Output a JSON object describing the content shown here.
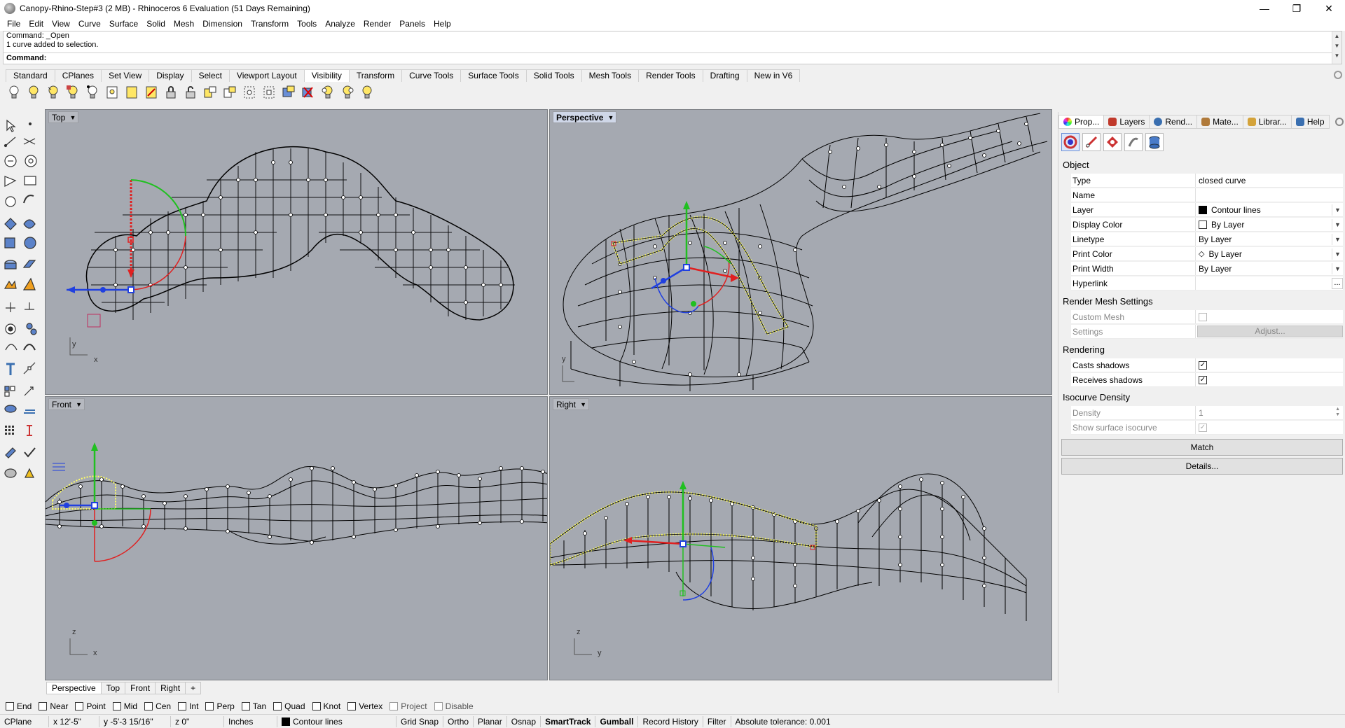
{
  "window": {
    "title": "Canopy-Rhino-Step#3 (2 MB) - Rhinoceros 6 Evaluation (51 Days Remaining)",
    "minimize": "—",
    "restore": "❐",
    "close": "✕"
  },
  "menu": [
    "File",
    "Edit",
    "View",
    "Curve",
    "Surface",
    "Solid",
    "Mesh",
    "Dimension",
    "Transform",
    "Tools",
    "Analyze",
    "Render",
    "Panels",
    "Help"
  ],
  "command": {
    "history": [
      "Command: _Open",
      "1 curve added to selection."
    ],
    "prompt": "Command:"
  },
  "toolbar_tabs": [
    "Standard",
    "CPlanes",
    "Set View",
    "Display",
    "Select",
    "Viewport Layout",
    "Visibility",
    "Transform",
    "Curve Tools",
    "Surface Tools",
    "Solid Tools",
    "Mesh Tools",
    "Render Tools",
    "Drafting",
    "New in V6"
  ],
  "toolbar_active": "Visibility",
  "viewports": {
    "top": "Top",
    "perspective": "Perspective",
    "front": "Front",
    "right": "Right",
    "axis_x": "x",
    "axis_y": "y",
    "axis_z": "z"
  },
  "viewport_tabs": [
    "Perspective",
    "Top",
    "Front",
    "Right",
    "+"
  ],
  "osnaps": [
    {
      "label": "End",
      "checked": false,
      "enabled": true
    },
    {
      "label": "Near",
      "checked": false,
      "enabled": true
    },
    {
      "label": "Point",
      "checked": false,
      "enabled": true
    },
    {
      "label": "Mid",
      "checked": false,
      "enabled": true
    },
    {
      "label": "Cen",
      "checked": false,
      "enabled": true
    },
    {
      "label": "Int",
      "checked": false,
      "enabled": true
    },
    {
      "label": "Perp",
      "checked": false,
      "enabled": true
    },
    {
      "label": "Tan",
      "checked": false,
      "enabled": true
    },
    {
      "label": "Quad",
      "checked": false,
      "enabled": true
    },
    {
      "label": "Knot",
      "checked": false,
      "enabled": true
    },
    {
      "label": "Vertex",
      "checked": false,
      "enabled": true
    },
    {
      "label": "Project",
      "checked": false,
      "enabled": false
    },
    {
      "label": "Disable",
      "checked": false,
      "enabled": false
    }
  ],
  "status": {
    "cplane": "CPlane",
    "x": "x 12'-5\"",
    "y": "y -5'-3 15/16\"",
    "z": "z 0\"",
    "units": "Inches",
    "layer": "Contour lines",
    "grid_snap": "Grid Snap",
    "ortho": "Ortho",
    "planar": "Planar",
    "osnap": "Osnap",
    "smarttrack": "SmartTrack",
    "gumball": "Gumball",
    "record_history": "Record History",
    "filter": "Filter",
    "tolerance": "Absolute tolerance: 0.001"
  },
  "panel": {
    "tabs": [
      {
        "label": "Prop...",
        "icon": "properties-icon",
        "color": "#e05a2b"
      },
      {
        "label": "Layers",
        "icon": "layers-icon",
        "color": "#c0392b"
      },
      {
        "label": "Rend...",
        "icon": "render-icon",
        "color": "#3a6fb0"
      },
      {
        "label": "Mate...",
        "icon": "material-icon",
        "color": "#b07a3a"
      },
      {
        "label": "Librar...",
        "icon": "library-icon",
        "color": "#d4a33a"
      },
      {
        "label": "Help",
        "icon": "help-icon",
        "color": "#3a6fb0"
      }
    ],
    "object_header": "Object",
    "rows": [
      {
        "key": "Type",
        "value": "closed curve"
      },
      {
        "key": "Name",
        "value": ""
      },
      {
        "key": "Layer",
        "value": "Contour lines"
      },
      {
        "key": "Display Color",
        "value": "By Layer"
      },
      {
        "key": "Linetype",
        "value": "By Layer"
      },
      {
        "key": "Print Color",
        "value": "By Layer"
      },
      {
        "key": "Print Width",
        "value": "By Layer"
      },
      {
        "key": "Hyperlink",
        "value": "",
        "button": "..."
      }
    ],
    "render_mesh_header": "Render Mesh Settings",
    "custom_mesh": "Custom Mesh",
    "settings": "Settings",
    "adjust": "Adjust...",
    "rendering_header": "Rendering",
    "casts_shadows": "Casts shadows",
    "receives_shadows": "Receives shadows",
    "isocurve_header": "Isocurve Density",
    "density": "Density",
    "density_value": "1",
    "show_isocurve": "Show surface isocurve",
    "match": "Match",
    "details": "Details..."
  },
  "colors": {
    "viewport_bg": "#a5a9b1",
    "wire": "#000000",
    "selected_curve": "#ffff66",
    "gumball_x": "#e02020",
    "gumball_y": "#20c020",
    "gumball_z": "#2040e0"
  }
}
